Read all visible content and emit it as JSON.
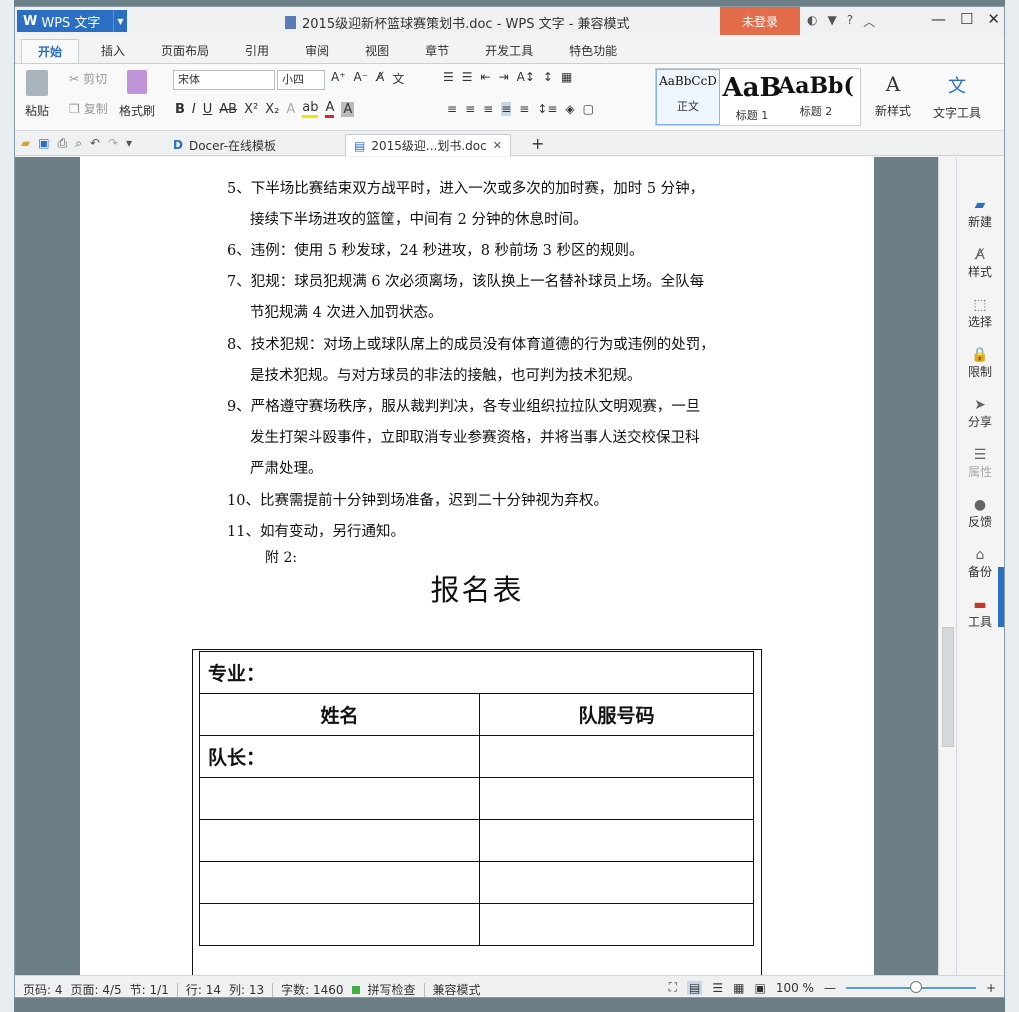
{
  "app": {
    "name": "WPS 文字",
    "doc_title": "2015级迎新杯篮球赛策划书.doc - WPS 文字 - 兼容模式",
    "login": "未登录"
  },
  "ribbon_tabs": [
    "开始",
    "插入",
    "页面布局",
    "引用",
    "审阅",
    "视图",
    "章节",
    "开发工具",
    "特色功能"
  ],
  "ribbon": {
    "paste": "粘贴",
    "cut": "剪切",
    "copy": "复制",
    "format_painter": "格式刷",
    "font": "宋体",
    "size": "小四",
    "new_style": "新样式",
    "text_tool": "文字工具"
  },
  "styles": [
    {
      "preview": "AaBbCcD",
      "name": "正文"
    },
    {
      "preview": "AaB",
      "name": "标题 1"
    },
    {
      "preview": "AaBb(",
      "name": "标题 2"
    }
  ],
  "doc_tabs": [
    {
      "label": "Docer-在线模板"
    },
    {
      "label": "2015级迎...划书.doc"
    }
  ],
  "body": {
    "lines": [
      "5、下半场比赛结束双方战平时，进入一次或多次的加时赛，加时 5 分钟，",
      "接续下半场进攻的篮筐，中间有 2 分钟的休息时间。",
      "6、违例：使用 5 秒发球，24 秒进攻，8 秒前场 3 秒区的规则。",
      "7、犯规：球员犯规满 6 次必须离场，该队换上一名替补球员上场。全队每",
      "节犯规满 4 次进入加罚状态。",
      "8、技术犯规：对场上或球队席上的成员没有体育道德的行为或违例的处罚，",
      "是技术犯规。与对方球员的非法的接触，也可判为技术犯规。",
      "9、严格遵守赛场秩序，服从裁判判决，各专业组织拉拉队文明观赛，一旦",
      "发生打架斗殴事件，立即取消专业参赛资格，并将当事人送交校保卫科",
      "严肃处理。",
      "10、比赛需提前十分钟到场准备，迟到二十分钟视为弃权。",
      "11、如有变动，另行通知。"
    ],
    "attachment": "附 2:",
    "form_title": "报名表",
    "table": {
      "major": "专业：",
      "col_name": "姓名",
      "col_number": "队服号码",
      "captain": "队长："
    }
  },
  "side_panel": [
    "新建",
    "样式",
    "选择",
    "限制",
    "分享",
    "属性",
    "反馈",
    "备份",
    "工具"
  ],
  "status": {
    "page": "页码: 4",
    "pages": "页面: 4/5",
    "section": "节: 1/1",
    "row": "行: 14",
    "col": "列: 13",
    "words": "字数: 1460",
    "spell": "拼写检查",
    "mode": "兼容模式",
    "zoom": "100 %"
  }
}
